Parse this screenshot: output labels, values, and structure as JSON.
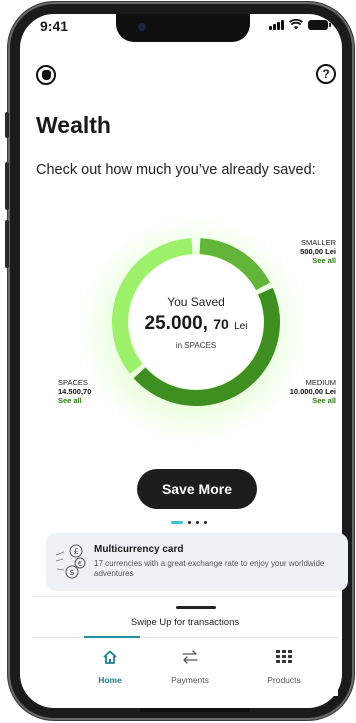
{
  "status_bar": {
    "time": "9:41"
  },
  "header": {
    "left_icon": "wallet-icon",
    "right_icon": "help-icon",
    "help_glyph": "?"
  },
  "page": {
    "title": "Wealth",
    "subtitle": "Check out how much you’ve already saved:"
  },
  "savings": {
    "label": "You Saved",
    "amount_int": "25.000,",
    "amount_dec": "70",
    "currency": "Lei",
    "source": "in SPACES",
    "segments": [
      {
        "name": "SMALLER",
        "amount": "500,00 Lei",
        "link": "See all",
        "color": "#63b53a"
      },
      {
        "name": "MEDIUM",
        "amount": "10.000,00 Lei",
        "link": "See all",
        "color": "#3e8f1f"
      },
      {
        "name": "SPACES",
        "amount": "14.500,70",
        "link": "See all",
        "color": "#9cf06a"
      }
    ]
  },
  "cta": {
    "label": "Save More"
  },
  "carousel": {
    "count": 4,
    "active_index": 0
  },
  "promo_card": {
    "title": "Multicurrency card",
    "description": "17 currencies with a great exchange rate to enjoy your worldwide adventures",
    "icon": "currency-exchange-icon"
  },
  "bottom_sheet": {
    "hint": "Swipe Up for transactions"
  },
  "tabs": [
    {
      "label": "Home",
      "icon": "home-icon",
      "active": true
    },
    {
      "label": "Payments",
      "icon": "transfer-icon",
      "active": false
    },
    {
      "label": "Products",
      "icon": "grid-icon",
      "active": false
    }
  ],
  "colors": {
    "accent": "#1a7f8e",
    "cta": "#1d1d1d",
    "link": "#2f7a17",
    "indicator": "#3cc0e0"
  }
}
